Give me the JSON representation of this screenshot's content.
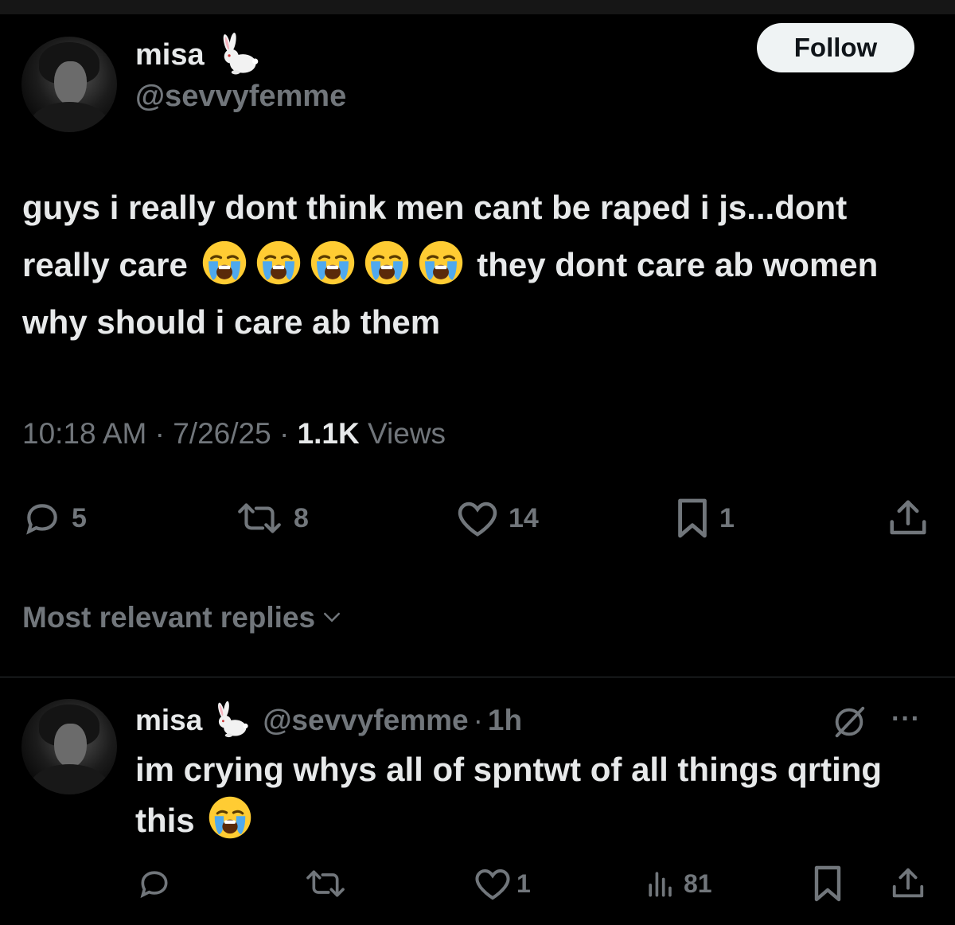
{
  "post": {
    "author": {
      "display_name": "misa",
      "emoji": "🐇",
      "handle": "@sevvyfemme"
    },
    "follow_label": "Follow",
    "text_parts": [
      "guys i really dont think men cant be raped i js...dont really care",
      "they dont care ab women why should i care ab them"
    ],
    "crying_emoji_count": 5,
    "time": "10:18 AM",
    "date": "7/26/25",
    "views_count": "1.1K",
    "views_label": "Views",
    "separator": "·",
    "actions": {
      "replies": "5",
      "reposts": "8",
      "likes": "14",
      "bookmarks": "1"
    }
  },
  "sort": {
    "label": "Most relevant replies"
  },
  "reply": {
    "author": {
      "display_name": "misa",
      "emoji": "🐇",
      "handle": "@sevvyfemme"
    },
    "separator": "·",
    "time": "1h",
    "more_label": "···",
    "text": "im crying whys all of spntwt of all things qrting this",
    "actions": {
      "likes": "1",
      "views": "81"
    }
  },
  "icons": {
    "reply": "reply-icon",
    "repost": "repost-icon",
    "like": "heart-icon",
    "bookmark": "bookmark-icon",
    "share": "share-icon",
    "views": "views-icon",
    "grok": "grok-icon",
    "more": "more-icon",
    "emoji": "loudly-crying-face"
  },
  "colors": {
    "background": "#000000",
    "text": "#e7e9ea",
    "muted": "#71767b",
    "button_bg": "#eff3f4",
    "divider": "#2f3336"
  }
}
